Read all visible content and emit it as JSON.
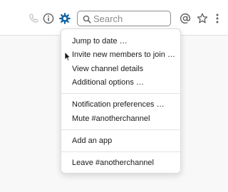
{
  "header": {
    "icons": [
      "phone-icon",
      "info-icon",
      "gear-icon",
      "at-icon",
      "star-icon",
      "more-vertical-icon"
    ],
    "search": {
      "placeholder": "Search",
      "value": ""
    },
    "accent_color": "#1264a3"
  },
  "menu": {
    "items": [
      {
        "label": "Jump to date …"
      },
      {
        "label": "Invite new members to join …"
      },
      {
        "label": "View channel details"
      },
      {
        "label": "Additional options …"
      },
      {
        "label": "Notification preferences …"
      },
      {
        "label": "Mute #anotherchannel"
      },
      {
        "label": "Add an app"
      },
      {
        "label": "Leave #anotherchannel"
      }
    ]
  }
}
